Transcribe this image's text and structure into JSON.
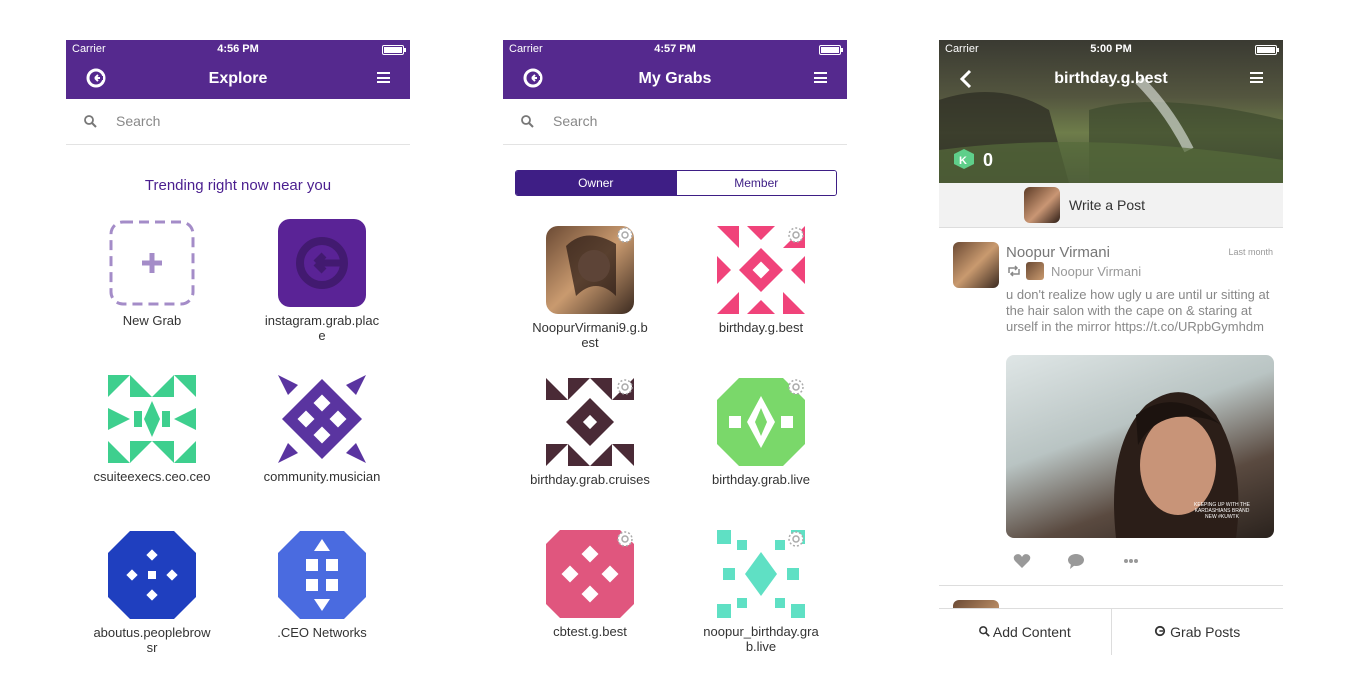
{
  "status": {
    "carrier": "Carrier",
    "time1": "4:56 PM",
    "time2": "4:57 PM",
    "time3": "5:00 PM"
  },
  "explore": {
    "title": "Explore",
    "search_placeholder": "Search",
    "trending": "Trending right now near you",
    "tiles": [
      "New Grab",
      "instagram.grab.place",
      "csuiteexecs.ceo.ceo",
      "community.musician",
      "aboutus.peoplebrowsr",
      ".CEO Networks"
    ]
  },
  "mygrabs": {
    "title": "My Grabs",
    "search_placeholder": "Search",
    "segments": [
      "Owner",
      "Member"
    ],
    "tiles": [
      "NoopurVirmani9.g.best",
      "birthday.g.best",
      "birthday.grab.cruises",
      "birthday.grab.live",
      "cbtest.g.best",
      "noopur_birthday.grab.live"
    ]
  },
  "grab": {
    "title": "birthday.g.best",
    "klout": "0",
    "write_post": "Write a Post",
    "post": {
      "author": "Noopur Virmani",
      "time": "Last month",
      "repost_author": "Noopur Virmani",
      "text": "u don't realize how ugly u are until ur sitting at the hair salon with the cape on & staring at urself in the mirror https://t.co/URpbGymhdm",
      "image_caption": "KEEPING UP WITH THE KARDASHIANS BRAND NEW #KUWTK"
    },
    "bottom": {
      "add_content": "Add Content",
      "grab_posts": "Grab Posts"
    }
  },
  "colors": {
    "brand": "#55298e",
    "accent": "#3e1e85"
  },
  "icons": [
    "grab-logo-icon",
    "menu-icon",
    "search-icon",
    "plus-icon",
    "gear-icon",
    "back-icon",
    "heart-icon",
    "comment-icon",
    "more-icon",
    "repost-icon",
    "klout-icon"
  ]
}
